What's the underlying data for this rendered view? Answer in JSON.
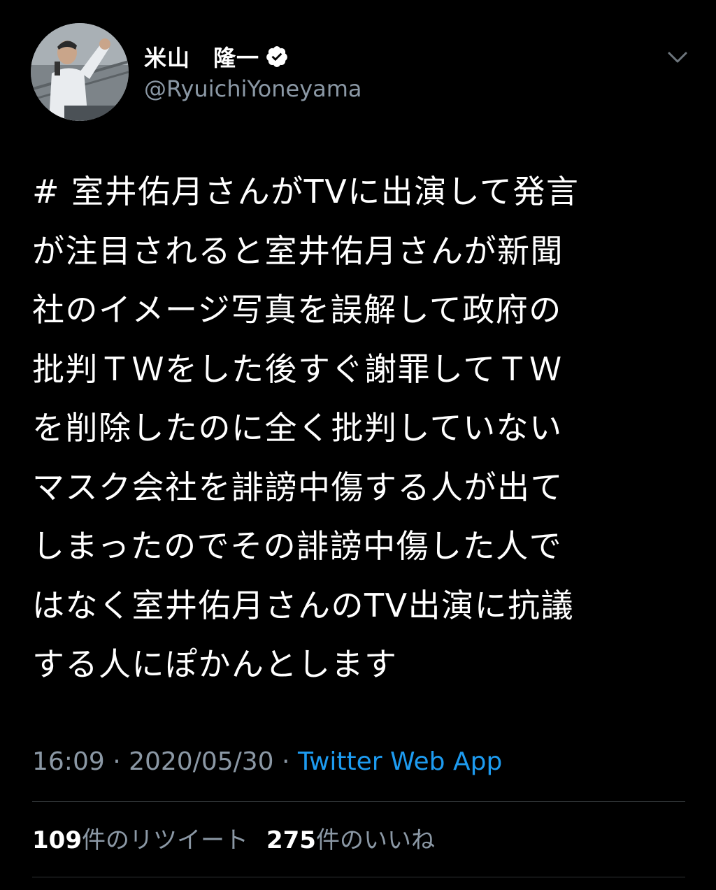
{
  "user": {
    "display_name": "米山　隆一",
    "handle": "@RyuichiYoneyama",
    "verified": true
  },
  "tweet": {
    "lines": [
      "# 室井佑月さんがTVに出演して発言",
      "が注目されると室井佑月さんが新聞",
      "社のイメージ写真を誤解して政府の",
      "批判ＴＷをした後すぐ謝罪してＴＷ",
      "を削除したのに全く批判していない",
      "マスク会社を誹謗中傷する人が出て",
      "しまったのでその誹謗中傷した人で",
      "はなく室井佑月さんのTV出演に抗議",
      "する人にぽかんとします"
    ],
    "time": "16:09",
    "separator": " · ",
    "date": "2020/05/30",
    "source": "Twitter Web App"
  },
  "stats": {
    "retweets_count": "109",
    "retweets_label": "件のリツイート",
    "likes_count": "275",
    "likes_label": "件のいいね"
  },
  "icons": {
    "verified": "verified-badge-icon",
    "more": "chevron-down-icon"
  },
  "colors": {
    "background": "#000000",
    "text": "#ffffff",
    "secondary": "#8b98a5",
    "link": "#1d9bf0",
    "divider": "#2f3336"
  }
}
